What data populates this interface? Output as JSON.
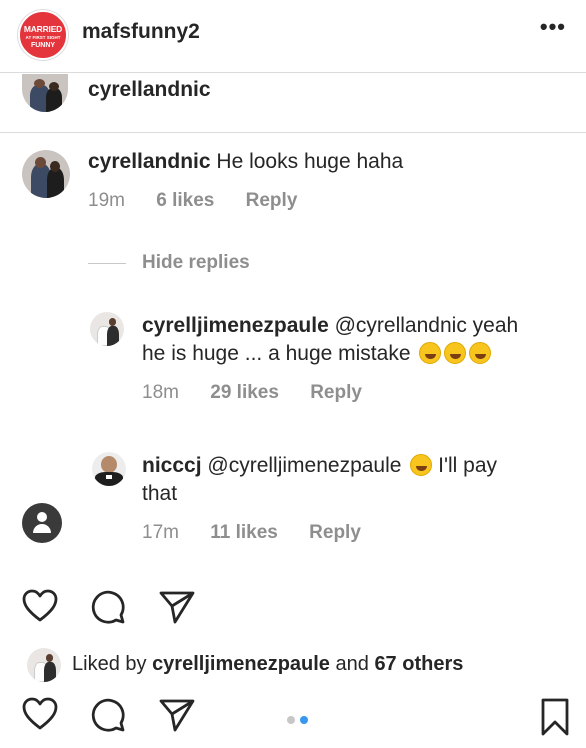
{
  "header": {
    "logo_line1": "MARRIED",
    "logo_line2": "AT FIRST SIGHT",
    "logo_line3": "FUNNY",
    "username": "mafsfunny2",
    "more": "•••"
  },
  "caption_user": "cyrellandnic",
  "comments": [
    {
      "user": "cyrellandnic",
      "text": "He looks huge haha",
      "time": "19m",
      "likes": "6 likes",
      "reply": "Reply"
    }
  ],
  "hide_replies": "Hide replies",
  "replies": [
    {
      "user": "cyrelljimenezpaule",
      "text_line1": "@cyrellandnic yeah",
      "text_line2": "he is huge ... a huge mistake",
      "emoji": "rolling-on-floor-laughing",
      "time": "18m",
      "likes": "29 likes",
      "reply": "Reply"
    },
    {
      "user": "nicccj",
      "text_line1": "@cyrelljimenezpaule",
      "text_after_emoji": "I'll pay",
      "text_line2": "that",
      "emoji": "tears-of-joy",
      "time": "17m",
      "likes": "11 likes",
      "reply": "Reply"
    }
  ],
  "liked_by": {
    "prefix": "Liked by",
    "user": "cyrelljimenezpaule",
    "middle": "and",
    "others": "67 others"
  },
  "icons": [
    "heart-icon",
    "comment-icon",
    "share-icon",
    "bookmark-icon"
  ],
  "carousel": {
    "count": 2,
    "active": 2,
    "active_color": "#3897f0",
    "inactive_color": "#c7c7c7"
  }
}
